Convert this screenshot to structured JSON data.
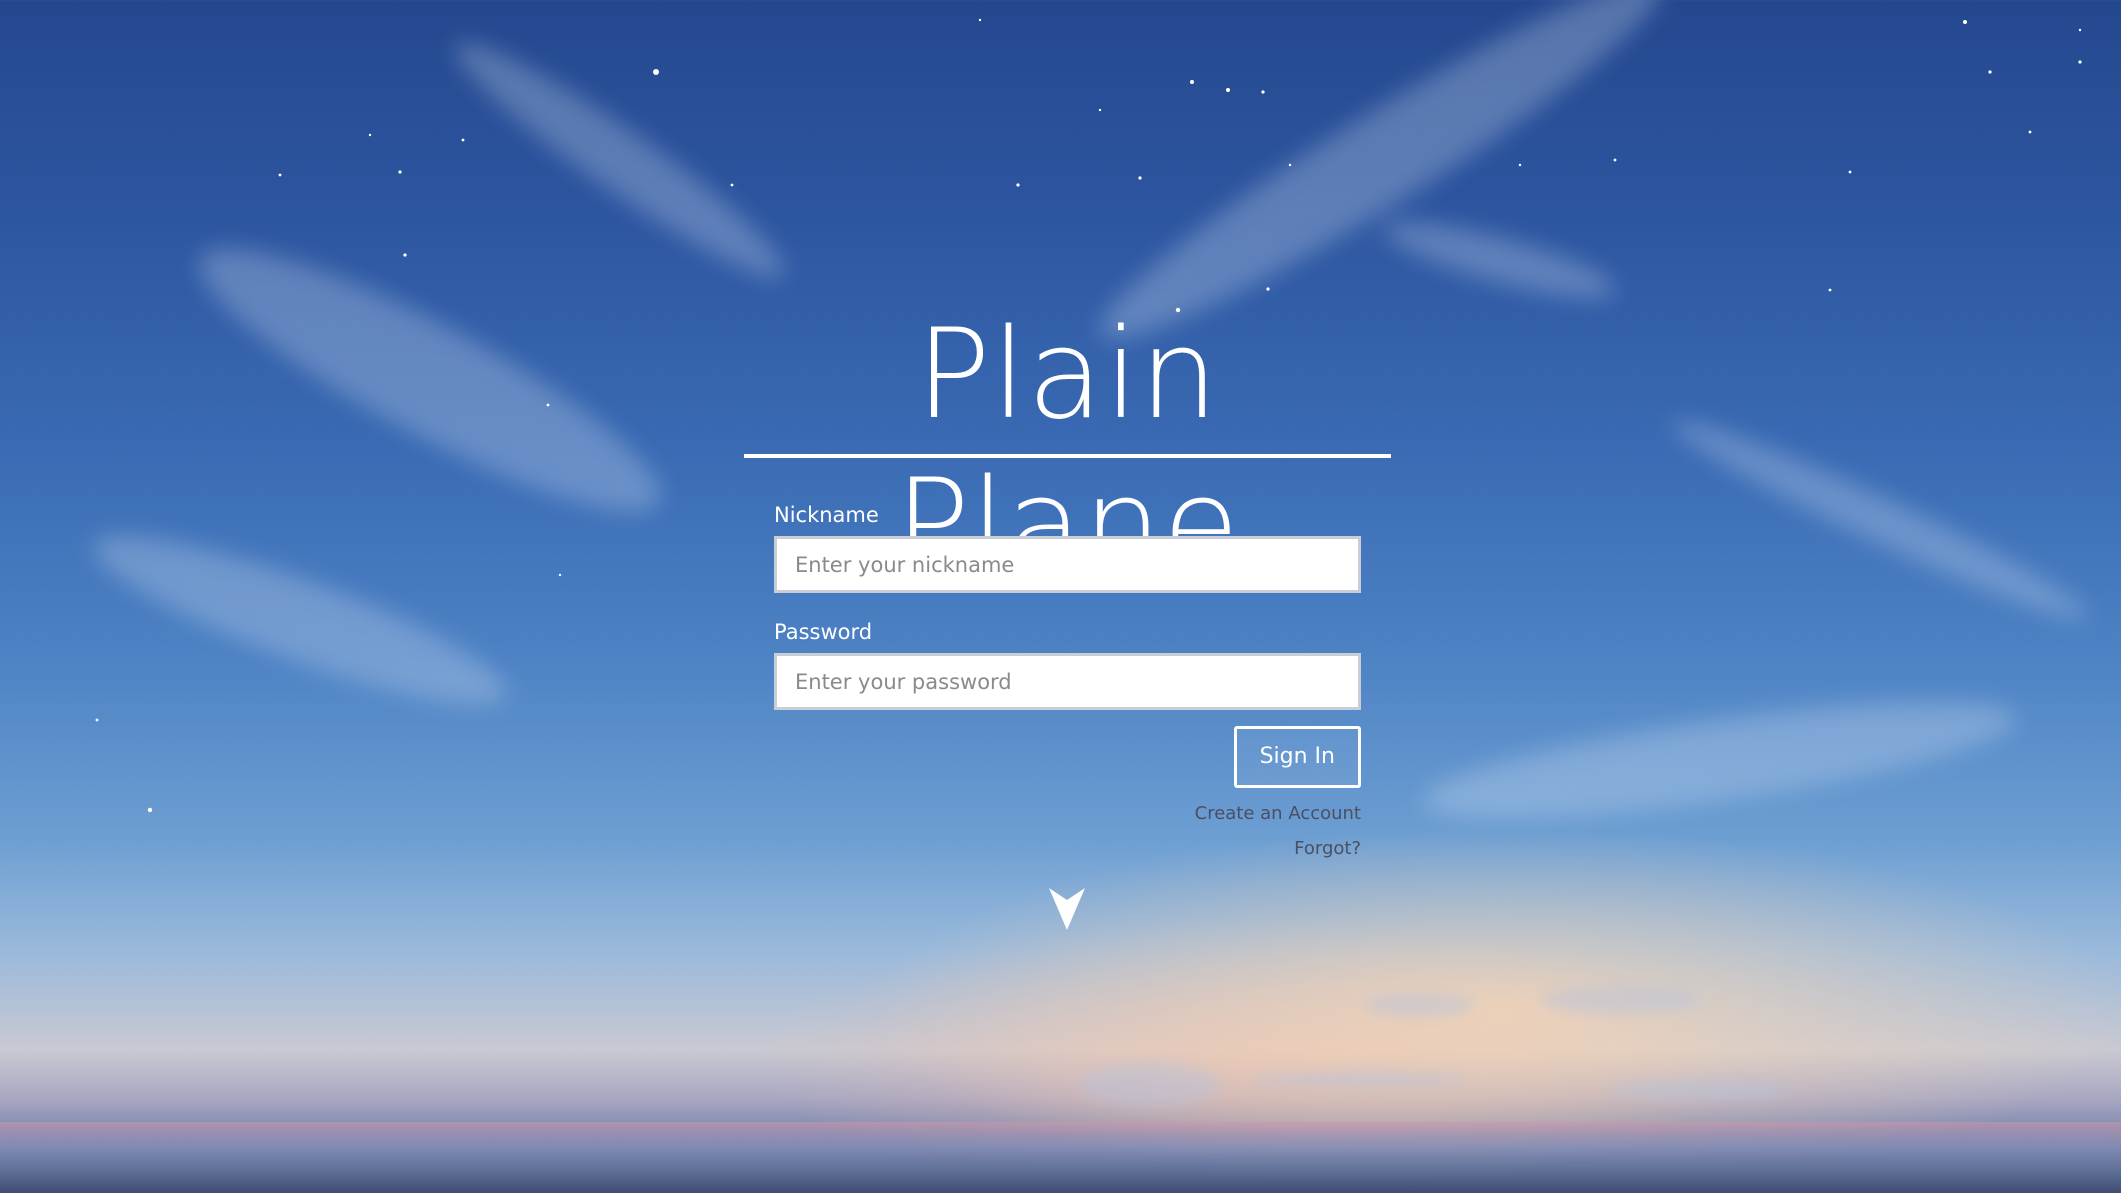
{
  "app": {
    "title": "Plain Plane"
  },
  "login": {
    "nickname_label": "Nickname",
    "nickname_placeholder": "Enter your nickname",
    "nickname_value": "",
    "password_label": "Password",
    "password_placeholder": "Enter your password",
    "password_value": "",
    "sign_in_label": "Sign In",
    "create_account_label": "Create an Account",
    "forgot_label": "Forgot?"
  },
  "icons": {
    "scroll_down": "paper-plane-arrow-icon"
  },
  "colors": {
    "text_primary": "#ffffff",
    "link_text": "#4a4f63",
    "input_border": "#c9ced6",
    "sky_top": "#24488f",
    "sky_horizon": "#f0d2b6"
  }
}
